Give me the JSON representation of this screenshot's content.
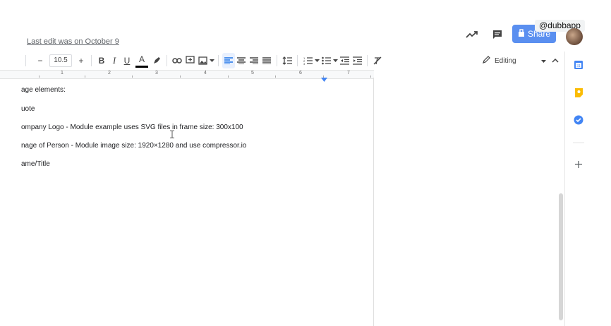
{
  "header": {
    "last_edit": "Last edit was on October 9",
    "share_label": "Share",
    "watermark": "@dubbapp",
    "icons": [
      "trending-up-icon",
      "comment-icon",
      "avatar"
    ]
  },
  "toolbar": {
    "decrease": "−",
    "font_size": "10.5",
    "increase": "+",
    "bold": "B",
    "italic": "I",
    "underline": "U",
    "text_color": "A",
    "editing_label": "Editing"
  },
  "ruler": {
    "numbers": [
      "1",
      "2",
      "3",
      "4",
      "5",
      "6",
      "7"
    ]
  },
  "document": {
    "lines": [
      "age elements:",
      "uote",
      "ompany Logo - Module example uses SVG files in frame size: 300x100",
      "nage of Person - Module image size: 1920×1280 and use compressor.io",
      "ame/Title"
    ]
  },
  "colors": {
    "share": "#5a8ff0",
    "accent": "#1a73e8",
    "calendar": "#4285f4",
    "keep": "#fbbc04",
    "tasks": "#4285f4"
  }
}
